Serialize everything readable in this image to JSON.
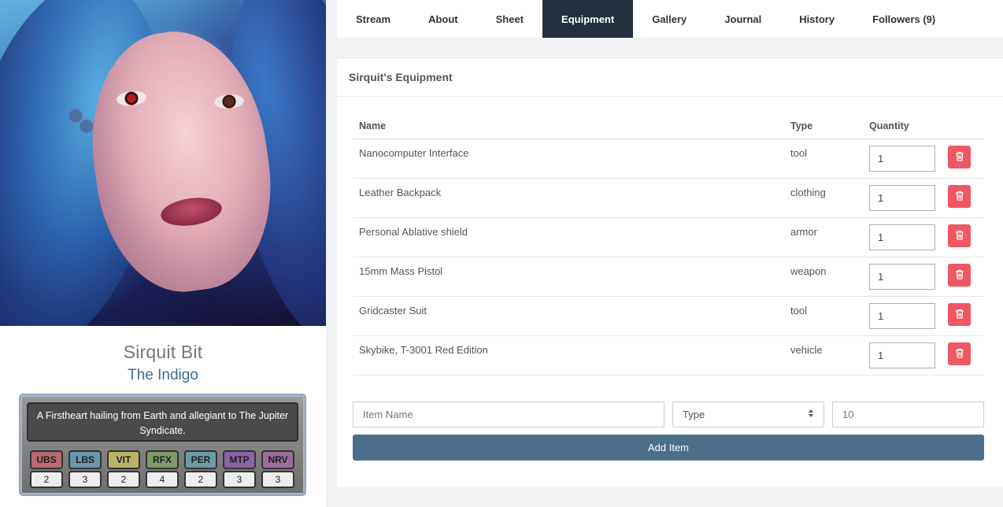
{
  "character": {
    "name": "Sirquit Bit",
    "title": "The Indigo",
    "description": "A Firstheart hailing from Earth and allegiant to The Jupiter Syndicate."
  },
  "stats": [
    {
      "label": "UBS",
      "value": "2",
      "color": "#b86a70"
    },
    {
      "label": "LBS",
      "value": "3",
      "color": "#6d95aa"
    },
    {
      "label": "VIT",
      "value": "2",
      "color": "#b9b36a"
    },
    {
      "label": "RFX",
      "value": "4",
      "color": "#7f9a6a"
    },
    {
      "label": "PER",
      "value": "2",
      "color": "#6e9aa4"
    },
    {
      "label": "MTP",
      "value": "3",
      "color": "#8a63a6"
    },
    {
      "label": "NRV",
      "value": "3",
      "color": "#9b6d98"
    }
  ],
  "tabs": [
    {
      "label": "Stream",
      "active": false
    },
    {
      "label": "About",
      "active": false
    },
    {
      "label": "Sheet",
      "active": false
    },
    {
      "label": "Equipment",
      "active": true
    },
    {
      "label": "Gallery",
      "active": false
    },
    {
      "label": "Journal",
      "active": false
    },
    {
      "label": "History",
      "active": false
    },
    {
      "label": "Followers (9)",
      "active": false
    }
  ],
  "equipment": {
    "heading": "Sirquit's Equipment",
    "columns": {
      "name": "Name",
      "type": "Type",
      "quantity": "Quantity"
    },
    "items": [
      {
        "name": "Nanocomputer Interface",
        "type": "tool",
        "quantity": "1"
      },
      {
        "name": "Leather Backpack",
        "type": "clothing",
        "quantity": "1"
      },
      {
        "name": "Personal Ablative shield",
        "type": "armor",
        "quantity": "1"
      },
      {
        "name": "15mm Mass Pistol",
        "type": "weapon",
        "quantity": "1"
      },
      {
        "name": "Gridcaster Suit",
        "type": "tool",
        "quantity": "1"
      },
      {
        "name": "Skybike, T-3001 Red Edition",
        "type": "vehicle",
        "quantity": "1"
      }
    ],
    "form": {
      "name_placeholder": "Item Name",
      "type_selected": "Type",
      "quantity_placeholder": "10",
      "add_label": "Add Item"
    }
  },
  "colors": {
    "active_tab": "#22303d",
    "delete": "#ef5763",
    "add_button": "#4d6e89",
    "title_accent": "#3f6d91"
  }
}
